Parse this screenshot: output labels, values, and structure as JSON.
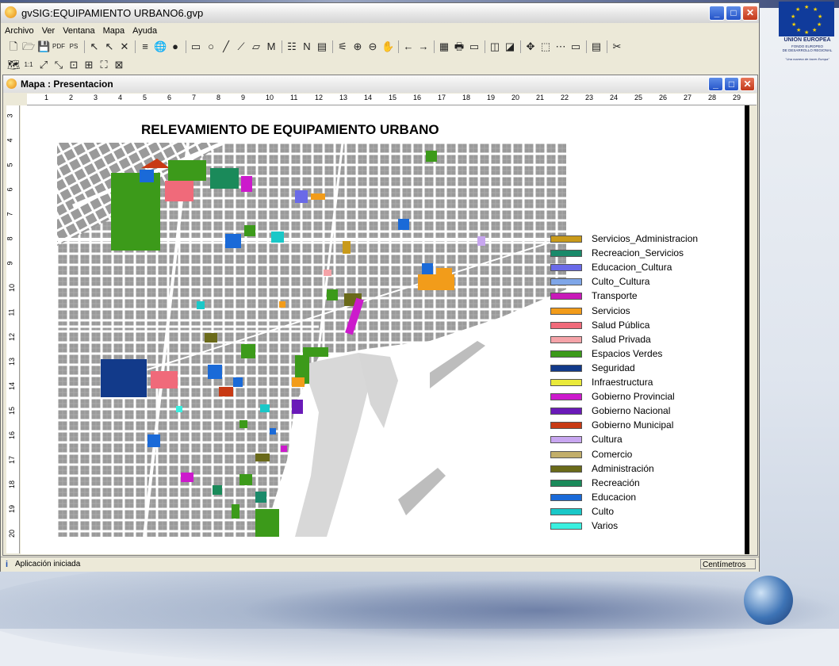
{
  "window": {
    "title": "gvSIG:EQUIPAMIENTO URBANO6.gvp",
    "minimize": "_",
    "maximize": "□",
    "close": "✕"
  },
  "menu": [
    "Archivo",
    "Ver",
    "Ventana",
    "Mapa",
    "Ayuda"
  ],
  "toolbar1_icons": [
    "new-file-icon",
    "open-folder-icon",
    "save-icon",
    "export-pdf-icon",
    "export-ps-icon",
    "select-pointer-icon",
    "arrow-pointer-icon",
    "delete-icon",
    "align-icon",
    "insert-view-icon",
    "point-icon",
    "rectangle-icon",
    "circle-icon",
    "line-icon",
    "polyline-icon",
    "polygon-icon",
    "text-icon",
    "legend-icon",
    "north-icon",
    "scale-bar-icon",
    "zoom-layout-icon",
    "zoom-in-icon",
    "zoom-out-icon",
    "pan-icon",
    "undo-icon",
    "redo-icon",
    "table-icon",
    "print-icon",
    "page-setup-icon",
    "group-icon",
    "ungroup-icon",
    "move-icon",
    "select-box-icon",
    "grid-icon",
    "frame-icon",
    "properties-icon",
    "tools-icon"
  ],
  "toolbar1_glyphs": [
    "🗋",
    "🗁",
    "💾",
    "PDF",
    "PS",
    "↖",
    "↖",
    "✕",
    "≡",
    "🌐",
    "●",
    "▭",
    "○",
    "╱",
    "⟋",
    "▱",
    "M",
    "☷",
    "N",
    "▤",
    "⚟",
    "⊕",
    "⊖",
    "✋",
    "←",
    "→",
    "▦",
    "🖶",
    "▭",
    "◫",
    "◪",
    "✥",
    "⬚",
    "⋯",
    "▭",
    "▤",
    "✂"
  ],
  "toolbar2_icons": [
    "zoom-full-icon",
    "zoom-real-icon",
    "expand-icon",
    "collapse-icon",
    "zoom-select-icon",
    "zoom-layout2-icon",
    "zoom-window-icon",
    "zoom-page-icon"
  ],
  "toolbar2_glyphs": [
    "🗺",
    "1:1",
    "⤢",
    "⤡",
    "⊡",
    "⊞",
    "⛶",
    "⊠"
  ],
  "inner_window": {
    "title": "Mapa : Presentacion"
  },
  "ruler_h": [
    "1",
    "2",
    "3",
    "4",
    "5",
    "6",
    "7",
    "8",
    "9",
    "10",
    "11",
    "12",
    "13",
    "14",
    "15",
    "16",
    "17",
    "18",
    "19",
    "20",
    "21",
    "22",
    "23",
    "24",
    "25",
    "26",
    "27",
    "28",
    "29"
  ],
  "ruler_v": [
    "3",
    "4",
    "5",
    "6",
    "7",
    "8",
    "9",
    "10",
    "11",
    "12",
    "13",
    "14",
    "15",
    "16",
    "17",
    "18",
    "19",
    "20"
  ],
  "map_title": "RELEVAMIENTO DE EQUIPAMIENTO URBANO",
  "legend": [
    {
      "label": "Servicios_Administracion",
      "color": "#c99a1a"
    },
    {
      "label": "Recreacion_Servicios",
      "color": "#1a8a6a"
    },
    {
      "label": "Educacion_Cultura",
      "color": "#6a6ae8"
    },
    {
      "label": "Culto_Cultura",
      "color": "#7fa6e8"
    },
    {
      "label": "Transporte",
      "color": "#c81ab8"
    },
    {
      "label": "Servicios",
      "color": "#f29c1a"
    },
    {
      "label": "Salud Pública",
      "color": "#f06a7a"
    },
    {
      "label": "Salud Privada",
      "color": "#f5a3a8"
    },
    {
      "label": "Espacios Verdes",
      "color": "#3c9a1a"
    },
    {
      "label": "Seguridad",
      "color": "#123a8a"
    },
    {
      "label": "Infraestructura",
      "color": "#eaea3a"
    },
    {
      "label": "Gobierno Provincial",
      "color": "#cc1acc"
    },
    {
      "label": "Gobierno Nacional",
      "color": "#6a1ab8"
    },
    {
      "label": "Gobierno Municipal",
      "color": "#c83a14"
    },
    {
      "label": "Cultura",
      "color": "#c8a6f0"
    },
    {
      "label": "Comercio",
      "color": "#c2ae6a"
    },
    {
      "label": "Administración",
      "color": "#6a6a1a"
    },
    {
      "label": "Recreación",
      "color": "#1a8a5a"
    },
    {
      "label": "Educacion",
      "color": "#1a6ad8"
    },
    {
      "label": "Culto",
      "color": "#1ac8c8"
    },
    {
      "label": "Varios",
      "color": "#3af0e0"
    }
  ],
  "status": {
    "message": "Aplicación iniciada",
    "unit": "Centímetros",
    "icon": "i"
  },
  "eu_logo": {
    "title": "UNIÓN EUROPEA",
    "sub1": "FONDO EUROPEO",
    "sub2": "DE DESARROLLO REGIONAL",
    "motto": "\"Una manera de hacer Europa\""
  }
}
